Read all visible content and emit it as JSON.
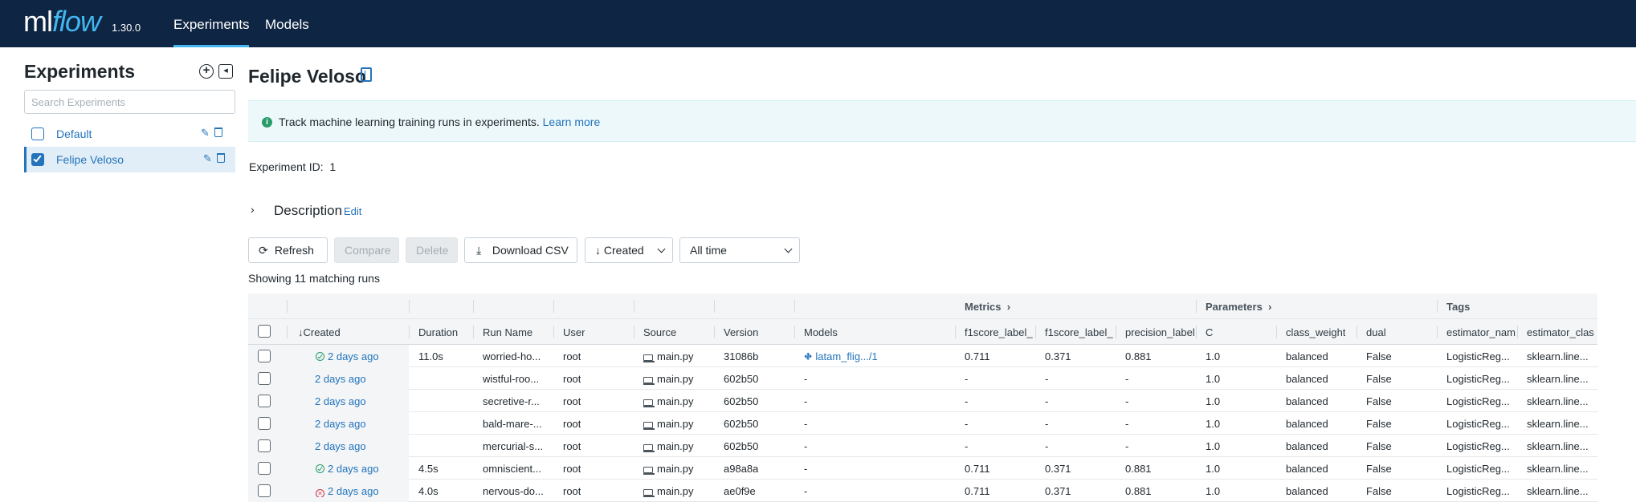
{
  "header": {
    "logo_ml": "ml",
    "logo_flow": "flow",
    "version": "1.30.0",
    "tabs": [
      {
        "label": "Experiments",
        "active": true
      },
      {
        "label": "Models",
        "active": false
      }
    ]
  },
  "sidebar": {
    "title": "Experiments",
    "add_icon": "⊕",
    "collapse_icon": "⊲",
    "search_placeholder": "Search Experiments",
    "items": [
      {
        "label": "Default",
        "checked": false
      },
      {
        "label": "Felipe Veloso",
        "checked": true
      }
    ]
  },
  "main": {
    "title": "Felipe Veloso",
    "info_text": "Track machine learning training runs in experiments.",
    "learn_more": "Learn more",
    "experiment_id_label": "Experiment ID:",
    "experiment_id": "1",
    "description_title": "Description",
    "description_edit": "Edit",
    "buttons": {
      "refresh": "Refresh",
      "compare": "Compare",
      "delete": "Delete",
      "download": "Download CSV",
      "sort": "Created",
      "time": "All time"
    },
    "showing": "Showing 11 matching runs"
  },
  "table": {
    "groups": {
      "metrics": "Metrics",
      "parameters": "Parameters",
      "tags": "Tags"
    },
    "columns": [
      "Created",
      "Duration",
      "Run Name",
      "User",
      "Source",
      "Version",
      "Models",
      "f1score_label_",
      "f1score_label_",
      "precision_label",
      "C",
      "class_weight",
      "dual",
      "estimator_nam",
      "estimator_clas"
    ],
    "rows": [
      {
        "status": "ok",
        "created": "2 days ago",
        "duration": "11.0s",
        "run_name": "worried-ho...",
        "user": "root",
        "source": "main.py",
        "version": "31086b",
        "models": "latam_flig.../1",
        "m1": "0.711",
        "m2": "0.371",
        "m3": "0.881",
        "c": "1.0",
        "class_weight": "balanced",
        "dual": "False",
        "estimator_name": "LogisticReg...",
        "estimator_class": "sklearn.line..."
      },
      {
        "status": "",
        "created": "2 days ago",
        "duration": "",
        "run_name": "wistful-roo...",
        "user": "root",
        "source": "main.py",
        "version": "602b50",
        "models": "-",
        "m1": "-",
        "m2": "-",
        "m3": "-",
        "c": "1.0",
        "class_weight": "balanced",
        "dual": "False",
        "estimator_name": "LogisticReg...",
        "estimator_class": "sklearn.line..."
      },
      {
        "status": "",
        "created": "2 days ago",
        "duration": "",
        "run_name": "secretive-r...",
        "user": "root",
        "source": "main.py",
        "version": "602b50",
        "models": "-",
        "m1": "-",
        "m2": "-",
        "m3": "-",
        "c": "1.0",
        "class_weight": "balanced",
        "dual": "False",
        "estimator_name": "LogisticReg...",
        "estimator_class": "sklearn.line..."
      },
      {
        "status": "",
        "created": "2 days ago",
        "duration": "",
        "run_name": "bald-mare-...",
        "user": "root",
        "source": "main.py",
        "version": "602b50",
        "models": "-",
        "m1": "-",
        "m2": "-",
        "m3": "-",
        "c": "1.0",
        "class_weight": "balanced",
        "dual": "False",
        "estimator_name": "LogisticReg...",
        "estimator_class": "sklearn.line..."
      },
      {
        "status": "",
        "created": "2 days ago",
        "duration": "",
        "run_name": "mercurial-s...",
        "user": "root",
        "source": "main.py",
        "version": "602b50",
        "models": "-",
        "m1": "-",
        "m2": "-",
        "m3": "-",
        "c": "1.0",
        "class_weight": "balanced",
        "dual": "False",
        "estimator_name": "LogisticReg...",
        "estimator_class": "sklearn.line..."
      },
      {
        "status": "ok",
        "created": "2 days ago",
        "duration": "4.5s",
        "run_name": "omniscient...",
        "user": "root",
        "source": "main.py",
        "version": "a98a8a",
        "models": "-",
        "m1": "0.711",
        "m2": "0.371",
        "m3": "0.881",
        "c": "1.0",
        "class_weight": "balanced",
        "dual": "False",
        "estimator_name": "LogisticReg...",
        "estimator_class": "sklearn.line..."
      },
      {
        "status": "fail",
        "created": "2 days ago",
        "duration": "4.0s",
        "run_name": "nervous-do...",
        "user": "root",
        "source": "main.py",
        "version": "ae0f9e",
        "models": "-",
        "m1": "0.711",
        "m2": "0.371",
        "m3": "0.881",
        "c": "1.0",
        "class_weight": "balanced",
        "dual": "False",
        "estimator_name": "LogisticReg...",
        "estimator_class": "sklearn.line..."
      }
    ]
  },
  "colors": {
    "topbar": "#0e2543",
    "accent": "#43b6f0",
    "link": "#2374bb",
    "success": "#2a9b6a",
    "error": "#d0344a"
  }
}
